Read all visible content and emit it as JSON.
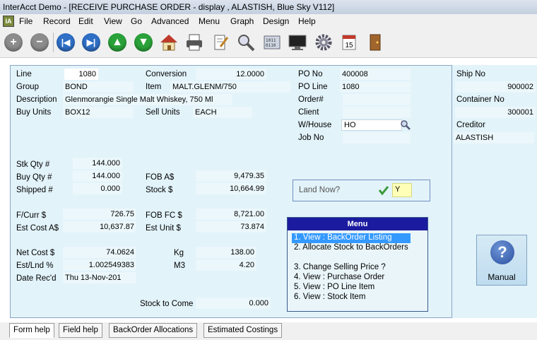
{
  "window": {
    "title": "InterAcct Demo - [RECEIVE PURCHASE ORDER - display , ALASTISH, Blue Sky V112]"
  },
  "menu": [
    "File",
    "Record",
    "Edit",
    "View",
    "Go",
    "Advanced",
    "Menu",
    "Graph",
    "Design",
    "Help"
  ],
  "toolbar": [
    "add-icon",
    "remove-icon",
    "first-icon",
    "last-icon",
    "up-icon",
    "down-icon",
    "home-icon",
    "print-icon",
    "edit-icon",
    "search-icon",
    "calculator-icon",
    "monitor-icon",
    "settings-icon",
    "calendar-icon",
    "exit-icon"
  ],
  "calendar_day": "15",
  "form": {
    "line": {
      "label": "Line",
      "value": "1080"
    },
    "group": {
      "label": "Group",
      "value": "BOND"
    },
    "description": {
      "label": "Description",
      "value": "Glenmorangie Single Malt Whiskey, 750 Ml"
    },
    "buy_units": {
      "label": "Buy Units",
      "value": "BOX12"
    },
    "conversion": {
      "label": "Conversion",
      "value": "12.0000"
    },
    "item": {
      "label": "Item",
      "value": "MALT.GLENM/750"
    },
    "sell_units": {
      "label": "Sell Units",
      "value": "EACH"
    },
    "po_no": {
      "label": "PO No",
      "value": "400008"
    },
    "po_line": {
      "label": "PO Line",
      "value": "1080"
    },
    "order_no": {
      "label": "Order#",
      "value": ""
    },
    "client": {
      "label": "Client",
      "value": ""
    },
    "warehouse": {
      "label": "W/House",
      "value": "HO"
    },
    "job_no": {
      "label": "Job No",
      "value": ""
    },
    "stk_qty": {
      "label": "Stk Qty #",
      "value": "144.000"
    },
    "buy_qty": {
      "label": "Buy Qty #",
      "value": "144.000"
    },
    "shipped": {
      "label": "Shipped #",
      "value": "0.000"
    },
    "fob_aud": {
      "label": "FOB A$",
      "value": "9,479.35"
    },
    "stock": {
      "label": "Stock $",
      "value": "10,664.99"
    },
    "fcurr": {
      "label": "F/Curr $",
      "value": "726.75"
    },
    "est_cost": {
      "label": "Est Cost A$",
      "value": "10,637.87"
    },
    "fob_fc": {
      "label": "FOB FC $",
      "value": "8,721.00"
    },
    "est_unit": {
      "label": "Est Unit $",
      "value": "73.874"
    },
    "net_cost": {
      "label": "Net Cost $",
      "value": "74.0624"
    },
    "est_lnd": {
      "label": "Est/Lnd %",
      "value": "1.002549383"
    },
    "date_recd": {
      "label": "Date Rec'd",
      "value": "Thu 13-Nov-201"
    },
    "kg": {
      "label": "Kg",
      "value": "138.00"
    },
    "m3": {
      "label": "M3",
      "value": "4.20"
    },
    "stock_to_come": {
      "label": "Stock to Come",
      "value": "0.000"
    }
  },
  "land_now": {
    "label": "Land Now?",
    "value": "Y"
  },
  "side": {
    "ship_no": {
      "label": "Ship No",
      "value": "900002"
    },
    "container_no": {
      "label": "Container No",
      "value": "300001"
    },
    "creditor": {
      "label": "Creditor",
      "value": "ALASTISH"
    }
  },
  "popup_menu": {
    "title": "Menu",
    "items": [
      "1. View : BackOrder Listing",
      "2. Allocate Stock to BackOrders",
      "",
      "3. Change Selling Price ?",
      "4. View : Purchase Order",
      "5. View : PO Line Item",
      "6. View : Stock Item"
    ]
  },
  "manual_button": {
    "label": "Manual"
  },
  "tabs": [
    "Form help",
    "Field help",
    "BackOrder Allocations",
    "Estimated Costings"
  ],
  "colors": {
    "menu_header": "#1b1ba0",
    "selection": "#3399ff",
    "panel": "#e2f3fa"
  }
}
